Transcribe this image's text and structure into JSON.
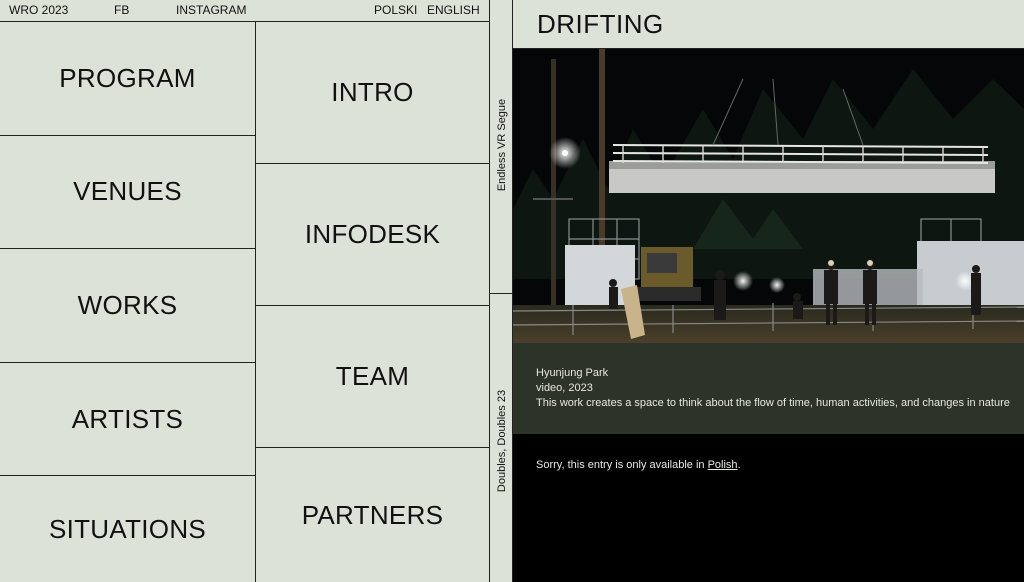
{
  "topbar": {
    "site": "WRO 2023",
    "fb": "FB",
    "instagram": "INSTAGRAM",
    "polish": "POLSKI",
    "english": "ENGLISH"
  },
  "nav_left": [
    "PROGRAM",
    "VENUES",
    "WORKS",
    "ARTISTS",
    "SITUATIONS"
  ],
  "nav_mid": [
    "INTRO",
    "INFODESK",
    "TEAM",
    "PARTNERS"
  ],
  "vertical_tabs": [
    "Endless VR Segue",
    "Doubles, Doubles 23"
  ],
  "work": {
    "title": "DRIFTING",
    "artist": "Hyunjung Park",
    "medium": "video, 2023",
    "description": "This work creates a space to think about the flow of time, human activities, and changes in nature",
    "note_prefix": "Sorry, this entry is only available in ",
    "note_link": "Polish",
    "note_suffix": "."
  },
  "colors": {
    "background": "#dde2d9",
    "info_panel": "#2c3328",
    "photo_bg": "#050607"
  }
}
